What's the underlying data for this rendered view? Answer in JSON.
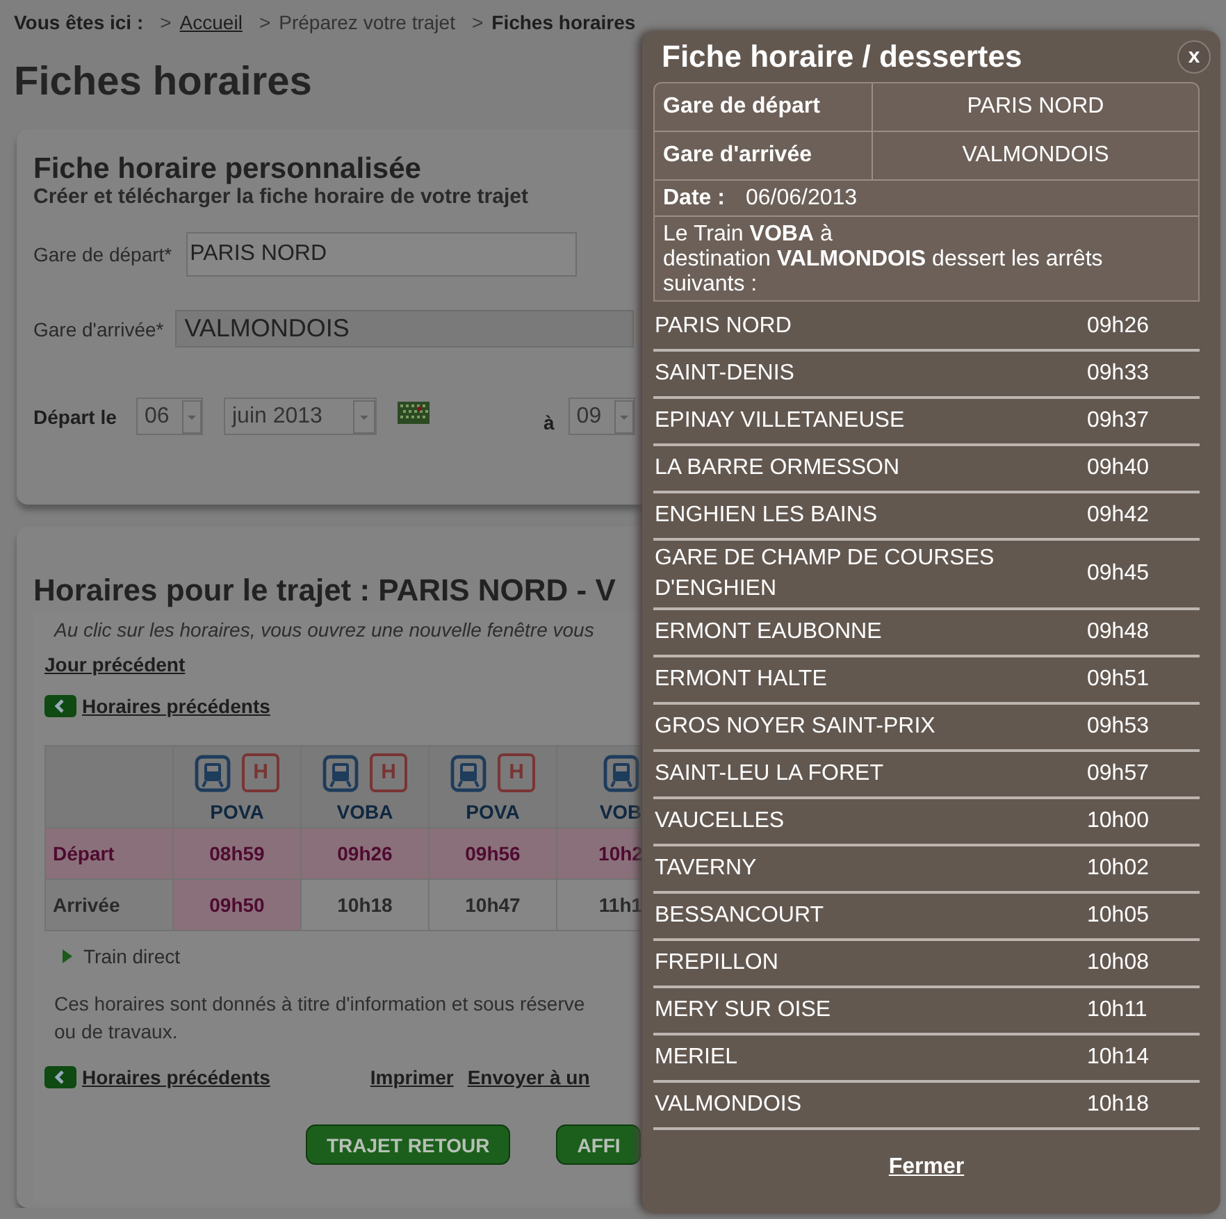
{
  "breadcrumb": {
    "label": "Vous êtes ici :",
    "items": [
      {
        "separator": ">",
        "text": "Accueil",
        "kind": "link"
      },
      {
        "separator": ">",
        "text": "Préparez votre trajet",
        "kind": "plain"
      },
      {
        "separator": ">",
        "text": "Fiches horaires",
        "kind": "current"
      }
    ]
  },
  "page_title": "Fiches horaires",
  "search_card": {
    "title": "Fiche horaire personnalisée",
    "subtitle": "Créer et télécharger la fiche horaire de votre trajet",
    "departure": {
      "label": "Gare de départ*",
      "value": "PARIS NORD"
    },
    "arrival": {
      "label": "Gare d'arrivée*",
      "value": "VALMONDOIS"
    },
    "date": {
      "label": "Départ le",
      "day": "06",
      "month": "juin 2013"
    },
    "time": {
      "label": "à",
      "hour": "09"
    }
  },
  "results": {
    "title": "Horaires pour le trajet : PARIS NORD - V",
    "notice": "Au clic sur les horaires, vous ouvrez une nouvelle fenêtre vous",
    "previous_day": "Jour précédent",
    "previous_times": "Horaires précédents",
    "row_labels": [
      "Départ",
      "Arrivée"
    ],
    "trains": [
      {
        "name": "POVA",
        "info_badge": "H",
        "departure": "08h59",
        "arrival": "09h50",
        "selected": true
      },
      {
        "name": "VOBA",
        "info_badge": "H",
        "departure": "09h26",
        "arrival": "10h18",
        "selected": false
      },
      {
        "name": "POVA",
        "info_badge": "H",
        "departure": "09h56",
        "arrival": "10h47",
        "selected": false
      },
      {
        "name": "VOB",
        "departure": "10h2",
        "arrival": "11h1",
        "selected": false
      }
    ],
    "legend": "Train direct",
    "disclaimer": [
      "Ces horaires sont donnés à titre d'information et sous réserve",
      "ou de travaux."
    ],
    "bottom_previous": "Horaires précédents",
    "print": "Imprimer",
    "send": "Envoyer à un",
    "buttons": [
      "TRAJET RETOUR",
      "AFFI"
    ]
  },
  "modal": {
    "title": "Fiche horaire / dessertes",
    "close": "x",
    "info": [
      {
        "label": "Gare de départ",
        "value": "PARIS NORD"
      },
      {
        "label": "Gare d'arrivée",
        "value": "VALMONDOIS"
      }
    ],
    "date": {
      "label": "Date :",
      "value": "06/06/2013"
    },
    "intro": "Le Train **VOBA** à\ndestination **VALMONDOIS** dessert les arrêts suivants :",
    "stops": [
      {
        "name": "PARIS NORD",
        "time": "09h26"
      },
      {
        "name": "SAINT-DENIS",
        "time": "09h33"
      },
      {
        "name": "EPINAY VILLETANEUSE",
        "time": "09h37"
      },
      {
        "name": "LA BARRE ORMESSON",
        "time": "09h40"
      },
      {
        "name": "ENGHIEN LES BAINS",
        "time": "09h42"
      },
      {
        "name": "GARE DE CHAMP DE COURSES D'ENGHIEN",
        "time": "09h45"
      },
      {
        "name": "ERMONT EAUBONNE",
        "time": "09h48"
      },
      {
        "name": "ERMONT HALTE",
        "time": "09h51"
      },
      {
        "name": "GROS NOYER SAINT-PRIX",
        "time": "09h53"
      },
      {
        "name": "SAINT-LEU LA FORET",
        "time": "09h57"
      },
      {
        "name": "VAUCELLES",
        "time": "10h00"
      },
      {
        "name": "TAVERNY",
        "time": "10h02"
      },
      {
        "name": "BESSANCOURT",
        "time": "10h05"
      },
      {
        "name": "FREPILLON",
        "time": "10h08"
      },
      {
        "name": "MERY SUR OISE",
        "time": "10h11"
      },
      {
        "name": "MERIEL",
        "time": "10h14"
      },
      {
        "name": "VALMONDOIS",
        "time": "10h18"
      }
    ],
    "close_link": "Fermer"
  }
}
